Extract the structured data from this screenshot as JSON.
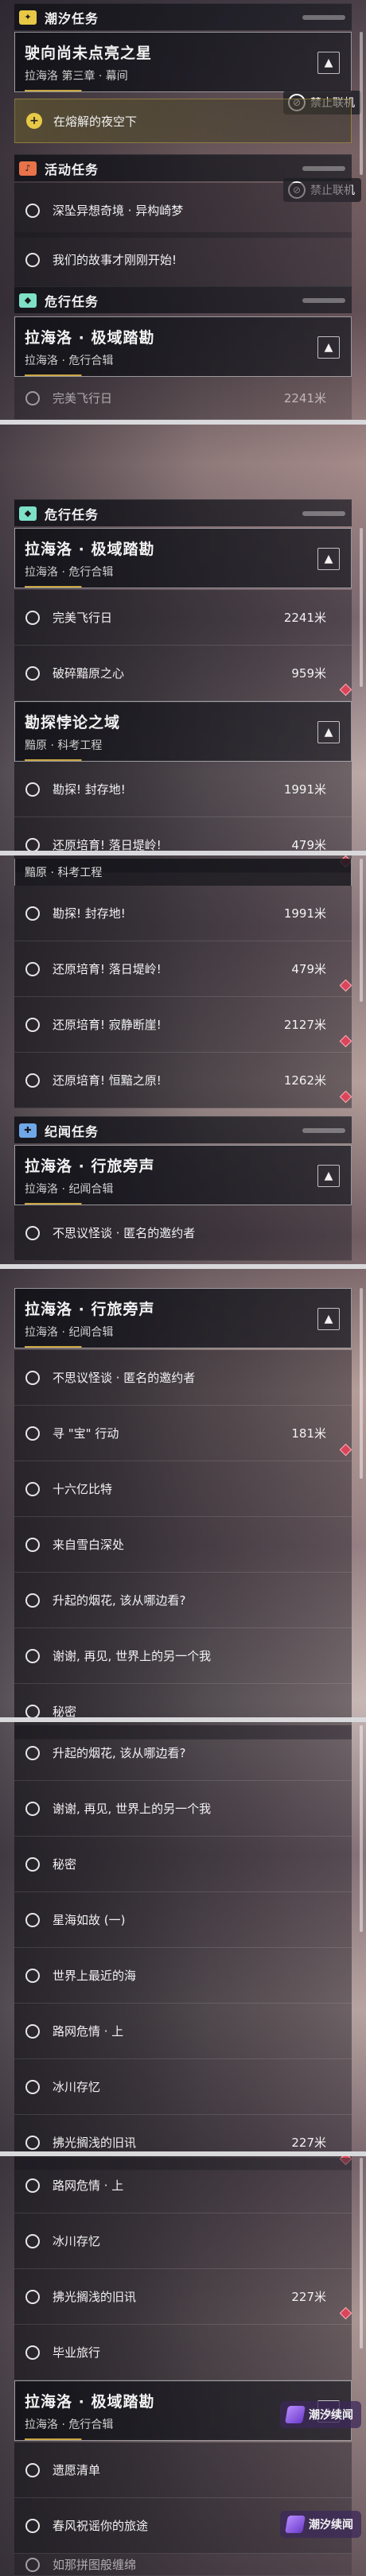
{
  "categories": {
    "tidal": "潮汐任务",
    "event": "活动任务",
    "danger": "危行任务",
    "record": "纪闻任务"
  },
  "badges": {
    "no_coop": "禁止联机",
    "tidal_chat": "潮汐续闻"
  },
  "tidal_group": {
    "title": "驶向尚未点亮之星",
    "sub": "拉海洛 第三章 · 幕间"
  },
  "tidal_item": "在熔解的夜空下",
  "event_items": [
    "深坠异想奇境 · 异构崎梦",
    "我们的故事才刚刚开始!"
  ],
  "danger_group_1": {
    "title": "拉海洛 · 极域踏勘",
    "sub": "拉海洛 · 危行合辑"
  },
  "danger_peek": {
    "label": "完美飞行日",
    "dist": "2241米"
  },
  "danger_items_1": [
    {
      "label": "完美飞行日",
      "dist": "2241米"
    },
    {
      "label": "破碎黯原之心",
      "dist": "959米"
    }
  ],
  "danger_group_2": {
    "title": "勘探悖论之域",
    "sub": "黯原 · 科考工程"
  },
  "danger_items_2": [
    {
      "label": "勘探! 封存地!",
      "dist": "1991米"
    },
    {
      "label": "还原培育! 落日堤岭!",
      "dist": "479米"
    }
  ],
  "danger_sub_repeat": "黯原 · 科考工程",
  "danger_items_3": [
    {
      "label": "勘探! 封存地!",
      "dist": "1991米"
    },
    {
      "label": "还原培育! 落日堤岭!",
      "dist": "479米"
    },
    {
      "label": "还原培育! 寂静断崖!",
      "dist": "2127米"
    },
    {
      "label": "还原培育! 恒黯之原!",
      "dist": "1262米"
    }
  ],
  "record_group": {
    "title": "拉海洛 · 行旅旁声",
    "sub": "拉海洛 · 纪闻合辑"
  },
  "record_item_1": "不思议怪谈 · 匿名的邀约者",
  "record_items_2": [
    {
      "label": "不思议怪谈 · 匿名的邀约者",
      "dist": ""
    },
    {
      "label": "寻 \"宝\" 行动",
      "dist": "181米"
    },
    {
      "label": "十六亿比特",
      "dist": ""
    },
    {
      "label": "来自雪白深处",
      "dist": ""
    },
    {
      "label": "升起的烟花, 该从哪边看?",
      "dist": ""
    },
    {
      "label": "谢谢, 再见, 世界上的另一个我",
      "dist": ""
    },
    {
      "label": "秘密",
      "dist": ""
    }
  ],
  "record_items_3": [
    {
      "label": "升起的烟花, 该从哪边看?",
      "dist": ""
    },
    {
      "label": "谢谢, 再见, 世界上的另一个我",
      "dist": ""
    },
    {
      "label": "秘密",
      "dist": ""
    },
    {
      "label": "星海如故 (一)",
      "dist": ""
    },
    {
      "label": "世界上最近的海",
      "dist": ""
    },
    {
      "label": "路网危情 · 上",
      "dist": ""
    },
    {
      "label": "冰川存忆",
      "dist": ""
    },
    {
      "label": "拂光搁浅的旧讯",
      "dist": "227米"
    }
  ],
  "record_items_4": [
    {
      "label": "路网危情 · 上",
      "dist": ""
    },
    {
      "label": "冰川存忆",
      "dist": ""
    },
    {
      "label": "拂光搁浅的旧讯",
      "dist": "227米"
    },
    {
      "label": "毕业旅行",
      "dist": ""
    }
  ],
  "danger_group_3": {
    "title": "拉海洛 · 极域踏勘",
    "sub": "拉海洛 · 危行合辑"
  },
  "final_items": [
    {
      "label": "遗愿清单",
      "dist": ""
    },
    {
      "label": "春风祝谣你的旅途",
      "dist": ""
    },
    {
      "label": "如那拼图般缠绵",
      "dist": ""
    }
  ]
}
